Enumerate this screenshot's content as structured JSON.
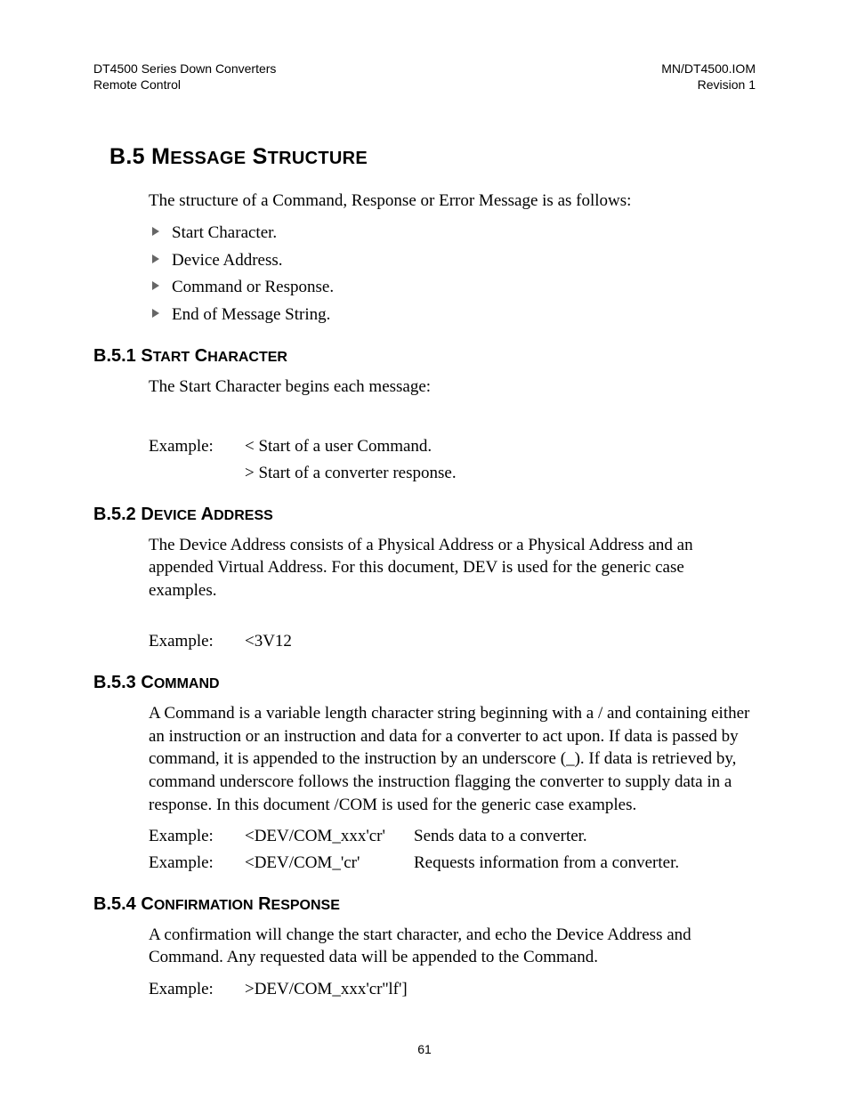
{
  "header": {
    "left1": "DT4500 Series Down Converters",
    "left2": "Remote Control",
    "right1": "MN/DT4500.IOM",
    "right2": "Revision 1"
  },
  "h_main": {
    "num": "B.5",
    "word1": "M",
    "rest1": "ESSAGE",
    "word2": "S",
    "rest2": "TRUCTURE"
  },
  "intro": "The structure of a Command, Response or Error Message is as follows:",
  "bullets": [
    "Start Character.",
    "Device Address.",
    "Command or Response.",
    "End of Message String."
  ],
  "s1": {
    "h": {
      "num": "B.5.1",
      "w1": "S",
      "r1": "TART",
      "w2": "C",
      "r2": "HARACTER"
    },
    "p1": "The Start Character begins each message:",
    "ex_label": "Example:",
    "ex1": "< Start of a user Command.",
    "ex2": "> Start of a converter response."
  },
  "s2": {
    "h": {
      "num": "B.5.2",
      "w1": "D",
      "r1": "EVICE",
      "w2": "A",
      "r2": "DDRESS"
    },
    "p1": "The Device Address consists of a Physical Address or a Physical Address and an appended Virtual Address.  For this document, DEV is used for the generic case examples.",
    "ex_label": "Example:",
    "ex1": "<3V12"
  },
  "s3": {
    "h": {
      "num": "B.5.3",
      "w1": "C",
      "r1": "OMMAND"
    },
    "p1": "A Command is a variable length character string beginning with a / and containing either an instruction or an instruction and data for a converter to act upon.  If data is passed by command, it is appended to the instruction by an underscore (_).  If data is retrieved by, command underscore follows the instruction flagging the converter to supply data in a response.  In this document /COM is used for the generic case examples.",
    "ex_label": "Example:",
    "ex1_code": "<DEV/COM_xxx'cr'",
    "ex1_desc": "Sends data to a converter.",
    "ex2_code": "<DEV/COM_'cr'",
    "ex2_desc": "Requests information from a converter."
  },
  "s4": {
    "h": {
      "num": "B.5.4",
      "w1": "C",
      "r1": "ONFIRMATION",
      "w2": "R",
      "r2": "ESPONSE"
    },
    "p1": "A confirmation will change the start character, and echo the Device Address and Command.  Any requested data will be appended to the Command.",
    "ex_label": "Example:",
    "ex1": ">DEV/COM_xxx'cr''lf']"
  },
  "page_num": "61"
}
